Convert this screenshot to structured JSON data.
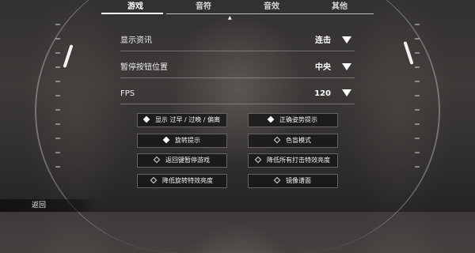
{
  "tabs": [
    {
      "label": "游戏",
      "active": true
    },
    {
      "label": "音符",
      "active": false
    },
    {
      "label": "音效",
      "active": false
    },
    {
      "label": "其他",
      "active": false
    }
  ],
  "settings": [
    {
      "label": "显示资讯",
      "value": "连击"
    },
    {
      "label": "暂停按钮位置",
      "value": "中央"
    },
    {
      "label": "FPS",
      "value": "120"
    }
  ],
  "toggles": [
    {
      "label": "显示 过早 / 过晚 / 偏离",
      "on": true
    },
    {
      "label": "正确姿势提示",
      "on": true
    },
    {
      "label": "旋转提示",
      "on": true
    },
    {
      "label": "色盲模式",
      "on": false
    },
    {
      "label": "返回键暂停游戏",
      "on": false
    },
    {
      "label": "降低所有打击特效亮度",
      "on": false
    },
    {
      "label": "降低旋转特效亮度",
      "on": false
    },
    {
      "label": "镜像谱面",
      "on": false
    }
  ],
  "footer": {
    "back_label": "返回"
  },
  "icons": {
    "dropdown": "triangle-down-icon",
    "toggle_on": "filled-diamond-icon",
    "toggle_off": "outline-diamond-icon"
  }
}
